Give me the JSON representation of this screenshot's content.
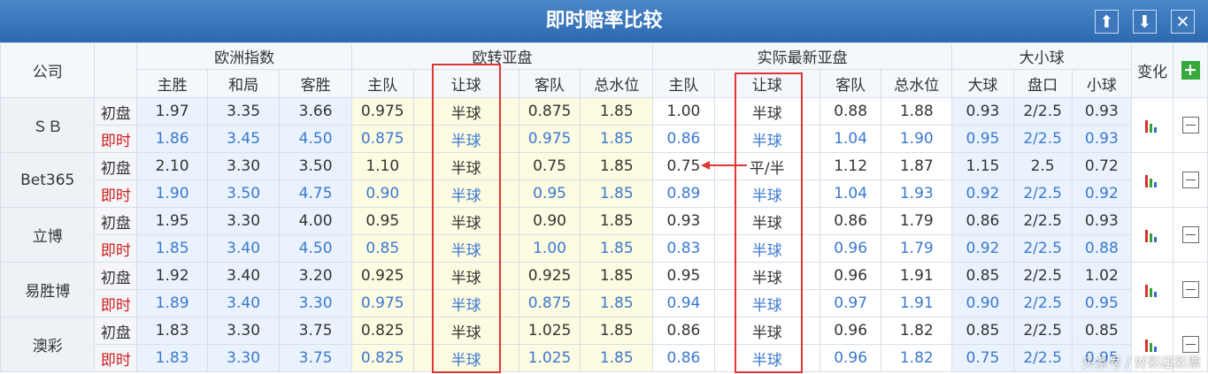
{
  "title": "即时赔率比较",
  "title_buttons": {
    "up_icon": "up-arrow-icon",
    "down_icon": "down-arrow-icon",
    "close_icon": "close-icon",
    "up": "⬆",
    "down": "⬇",
    "close": "✕"
  },
  "header": {
    "company": "公司",
    "groups": [
      "欧洲指数",
      "欧转亚盘",
      "实际最新亚盘",
      "大小球"
    ],
    "change": "变化",
    "add_icon": "plus-icon",
    "add": "+",
    "sub": [
      "主胜",
      "和局",
      "客胜",
      "主队",
      "让球",
      "客队",
      "总水位",
      "主队",
      "让球",
      "客队",
      "总水位",
      "大球",
      "盘口",
      "小球"
    ]
  },
  "row_labels": {
    "init": "初盘",
    "live": "即时"
  },
  "companies": [
    {
      "name": "ＳＢ",
      "init": [
        "1.97",
        "3.35",
        "3.66",
        "0.975",
        "半球",
        "0.875",
        "1.85",
        "1.00",
        "半球",
        "0.88",
        "1.88",
        "0.93",
        "2/2.5",
        "0.93"
      ],
      "live": [
        "1.86",
        "3.45",
        "4.50",
        "0.875",
        "半球",
        "0.975",
        "1.85",
        "0.86",
        "半球",
        "1.04",
        "1.90",
        "0.95",
        "2/2.5",
        "0.93"
      ]
    },
    {
      "name": "Bet365",
      "init": [
        "2.10",
        "3.30",
        "3.50",
        "1.10",
        "半球",
        "0.75",
        "1.85",
        "0.75",
        "平/半",
        "1.12",
        "1.87",
        "1.15",
        "2.5",
        "0.72"
      ],
      "live": [
        "1.90",
        "3.50",
        "4.75",
        "0.90",
        "半球",
        "0.95",
        "1.85",
        "0.89",
        "半球",
        "1.04",
        "1.93",
        "0.92",
        "2/2.5",
        "0.92"
      ]
    },
    {
      "name": "立博",
      "init": [
        "1.95",
        "3.30",
        "4.00",
        "0.95",
        "半球",
        "0.90",
        "1.85",
        "0.93",
        "半球",
        "0.86",
        "1.79",
        "0.86",
        "2/2.5",
        "0.93"
      ],
      "live": [
        "1.85",
        "3.40",
        "4.50",
        "0.85",
        "半球",
        "1.00",
        "1.85",
        "0.83",
        "半球",
        "0.96",
        "1.79",
        "0.92",
        "2/2.5",
        "0.88"
      ]
    },
    {
      "name": "易胜博",
      "init": [
        "1.92",
        "3.40",
        "3.20",
        "0.925",
        "半球",
        "0.925",
        "1.85",
        "0.95",
        "半球",
        "0.96",
        "1.91",
        "0.85",
        "2/2.5",
        "1.02"
      ],
      "live": [
        "1.89",
        "3.40",
        "3.30",
        "0.975",
        "半球",
        "0.875",
        "1.85",
        "0.94",
        "半球",
        "0.97",
        "1.91",
        "0.90",
        "2/2.5",
        "0.95"
      ]
    },
    {
      "name": "澳彩",
      "init": [
        "1.83",
        "3.30",
        "3.75",
        "0.825",
        "半球",
        "1.025",
        "1.85",
        "0.86",
        "半球",
        "0.96",
        "1.82",
        "0.85",
        "2/2.5",
        "0.85"
      ],
      "live": [
        "1.83",
        "3.30",
        "3.75",
        "0.825",
        "半球",
        "1.025",
        "1.85",
        "0.86",
        "半球",
        "0.96",
        "1.82",
        "0.75",
        "2/2.5",
        "0.95"
      ]
    }
  ],
  "change_icon": "bar-chart-icon",
  "collapse_icon": "minus-icon",
  "bar_colors": [
    "#d9302b",
    "#3a9c3a",
    "#2f6fc4"
  ],
  "annotation_color": "#e03636",
  "watermark": "头条号 / 好彩店彩票"
}
